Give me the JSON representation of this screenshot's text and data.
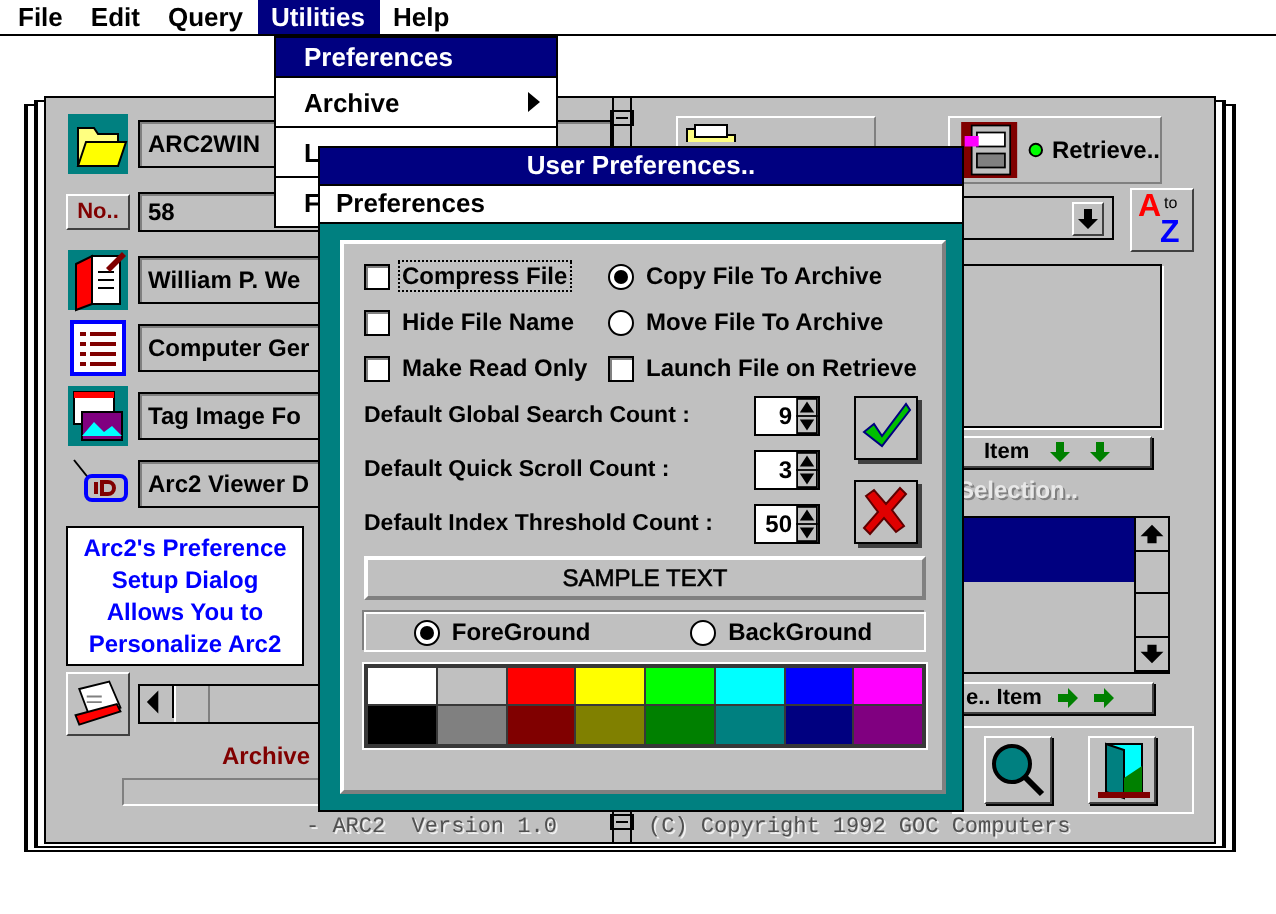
{
  "menu_bar": [
    {
      "label": "File",
      "selected": false
    },
    {
      "label": "Edit",
      "selected": false
    },
    {
      "label": "Query",
      "selected": false
    },
    {
      "label": "Utilities",
      "selected": true
    },
    {
      "label": "Help",
      "selected": false
    }
  ],
  "utilities_menu": [
    {
      "label": "Preferences",
      "kind": "item",
      "selected": true
    },
    {
      "label": "Archive",
      "kind": "submenu",
      "selected": false
    },
    {
      "label": "L",
      "kind": "item",
      "selected": false
    },
    {
      "label": "F",
      "kind": "item",
      "selected": false
    }
  ],
  "left_page": {
    "records": [
      {
        "kind": "folder",
        "value": "ARC2WIN"
      },
      {
        "kind": "number",
        "button": "No..",
        "value": "58"
      },
      {
        "kind": "author",
        "value": "William P. We"
      },
      {
        "kind": "list",
        "value": "Computer Ger"
      },
      {
        "kind": "image",
        "value": "Tag Image Fo"
      },
      {
        "kind": "viewer",
        "value": "Arc2 Viewer D"
      }
    ],
    "note": [
      "Arc2's Preference",
      "Setup Dialog",
      "Allows You to",
      "Personalize Arc2"
    ],
    "status": "Archive",
    "footer": "- ARC2  Version 1.0"
  },
  "right_page": {
    "retrieve_button": "Retrieve..",
    "sort_button": [
      "A",
      "to",
      "Z"
    ],
    "top_item_button": "Item",
    "selection_label": "Selection..",
    "list_rows": [
      {
        "selected": true
      },
      {
        "selected": false
      }
    ],
    "bottom_item_button": "e.. Item",
    "footer": "(C) Copyright 1992 GOC Computers"
  },
  "dialog": {
    "title": "User Preferences..",
    "menu": "Preferences",
    "options": [
      {
        "kind": "checkbox",
        "label": "Compress File",
        "checked": false,
        "focused": true
      },
      {
        "kind": "radio",
        "label": "Copy File To Archive",
        "checked": true,
        "focused": false
      },
      {
        "kind": "checkbox",
        "label": "Hide File Name",
        "checked": false,
        "focused": false
      },
      {
        "kind": "radio",
        "label": "Move File To Archive",
        "checked": false,
        "focused": false
      },
      {
        "kind": "checkbox",
        "label": "Make Read Only",
        "checked": false,
        "focused": false
      },
      {
        "kind": "checkbox",
        "label": "Launch File on Retrieve",
        "checked": false,
        "focused": false
      }
    ],
    "counts": [
      {
        "label": "Default Global Search Count :",
        "value": "9"
      },
      {
        "label": "Default Quick Scroll  Count :",
        "value": "3"
      },
      {
        "label": "Default Index Threshold Count :",
        "value": "50"
      }
    ],
    "sample_text": "SAMPLE TEXT",
    "color_targets": [
      {
        "label": "ForeGround",
        "selected": true
      },
      {
        "label": "BackGround",
        "selected": false
      }
    ],
    "palette": [
      {
        "color": "#ffffff"
      },
      {
        "color": "#c0c0c0"
      },
      {
        "color": "#ff0000"
      },
      {
        "color": "#ffff00"
      },
      {
        "color": "#00ff00"
      },
      {
        "color": "#00ffff"
      },
      {
        "color": "#0000ff"
      },
      {
        "color": "#ff00ff"
      },
      {
        "color": "#000000"
      },
      {
        "color": "#808080"
      },
      {
        "color": "#800000"
      },
      {
        "color": "#808000"
      },
      {
        "color": "#008000"
      },
      {
        "color": "#008080"
      },
      {
        "color": "#000080"
      },
      {
        "color": "#800080"
      }
    ]
  }
}
